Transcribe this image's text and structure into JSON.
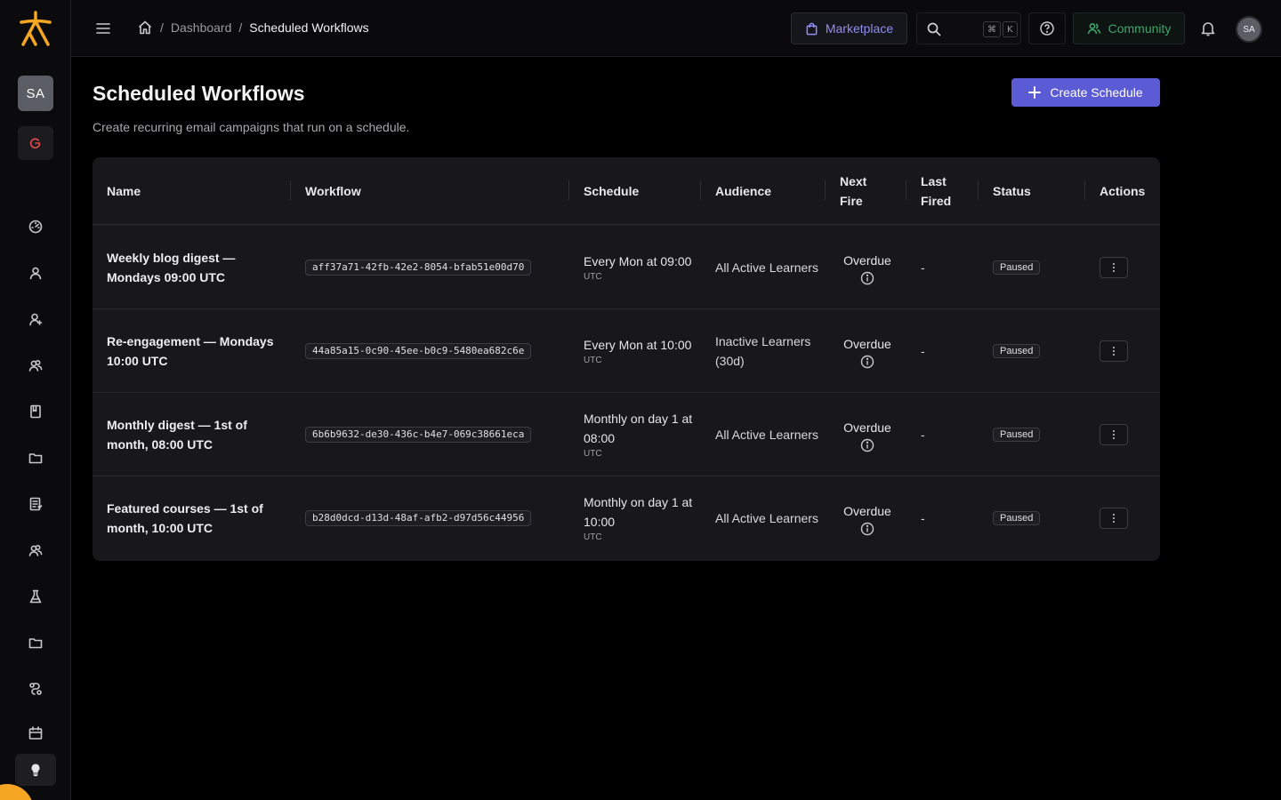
{
  "sidebar": {
    "avatar_initials": "SA",
    "icons": [
      "power-icon",
      "dashboard-icon",
      "user-icon",
      "user-add-icon",
      "users-icon",
      "book-icon",
      "folder-icon",
      "report-icon",
      "team-icon",
      "flask-icon",
      "folder-icon",
      "workflow-icon",
      "calendar-icon",
      "lightbulb-icon"
    ]
  },
  "topbar": {
    "breadcrumb": {
      "home_icon": "home-icon",
      "separator": "/",
      "items": [
        "Dashboard",
        "Scheduled Workflows"
      ]
    },
    "marketplace_label": "Marketplace",
    "search_shortcut": [
      "⌘",
      "K"
    ],
    "community_label": "Community",
    "avatar_initials": "SA"
  },
  "page": {
    "title": "Scheduled Workflows",
    "subtitle": "Create recurring email campaigns that run on a schedule.",
    "create_button_label": "Create Schedule"
  },
  "table": {
    "headers": {
      "name": "Name",
      "workflow": "Workflow",
      "schedule": "Schedule",
      "audience": "Audience",
      "next_fire_1": "Next",
      "next_fire_2": "Fire",
      "last_fired_1": "Last",
      "last_fired_2": "Fired",
      "status": "Status",
      "actions": "Actions"
    },
    "rows": [
      {
        "name": "Weekly blog digest — Mondays 09:00 UTC",
        "workflow": "aff37a71-42fb-42e2-8054-bfab51e00d70",
        "schedule": "Every Mon at 09:00",
        "timezone": "UTC",
        "audience": "All Active Learners",
        "next_fire": "Overdue",
        "last_fired": "-",
        "status": "Paused"
      },
      {
        "name": "Re-engagement — Mondays 10:00 UTC",
        "workflow": "44a85a15-0c90-45ee-b0c9-5480ea682c6e",
        "schedule": "Every Mon at 10:00",
        "timezone": "UTC",
        "audience": "Inactive Learners (30d)",
        "next_fire": "Overdue",
        "last_fired": "-",
        "status": "Paused"
      },
      {
        "name": "Monthly digest — 1st of month, 08:00 UTC",
        "workflow": "6b6b9632-de30-436c-b4e7-069c38661eca",
        "schedule": "Monthly on day 1 at 08:00",
        "timezone": "UTC",
        "audience": "All Active Learners",
        "next_fire": "Overdue",
        "last_fired": "-",
        "status": "Paused"
      },
      {
        "name": "Featured courses — 1st of month, 10:00 UTC",
        "workflow": "b28d0dcd-d13d-48af-afb2-d97d56c44956",
        "schedule": "Monthly on day 1 at 10:00",
        "timezone": "UTC",
        "audience": "All Active Learners",
        "next_fire": "Overdue",
        "last_fired": "-",
        "status": "Paused"
      }
    ]
  },
  "colors": {
    "accent": "#5b5bd6",
    "marketplace": "#8f8ef0",
    "community": "#3ea56b",
    "brand": "#f5a623",
    "background": "#000000",
    "card": "#18181b"
  }
}
